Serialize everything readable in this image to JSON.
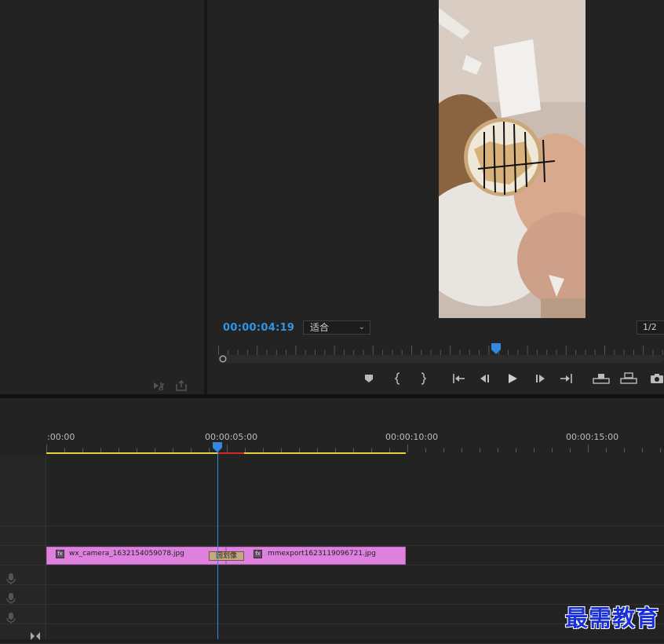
{
  "monitor": {
    "timecode": "00:00:04:19",
    "fit_label": "适合",
    "resolution": "1/2",
    "playhead_position_pct": 63
  },
  "transport": {
    "buttons": [
      "add-marker",
      "mark-in",
      "mark-out",
      "go-to-in",
      "step-back",
      "play",
      "step-forward",
      "go-to-out",
      "lift",
      "extract",
      "export-frame"
    ]
  },
  "timeline": {
    "time_labels": [
      ":00:00",
      "00:00:05:00",
      "00:00:10:00",
      "00:00:15:00"
    ],
    "clips": [
      {
        "name": "wx_camera_1632154059078.jpg",
        "fx": "fx"
      },
      {
        "name": "mmexport1623119096721.jpg",
        "fx": "fx"
      }
    ],
    "transition_label": "圆划像"
  },
  "watermark": "最需教育",
  "colors": {
    "timecode": "#2f95e6",
    "clip": "#de80de",
    "workarea": "#e4d33a",
    "playhead": "#2f8ae0"
  }
}
